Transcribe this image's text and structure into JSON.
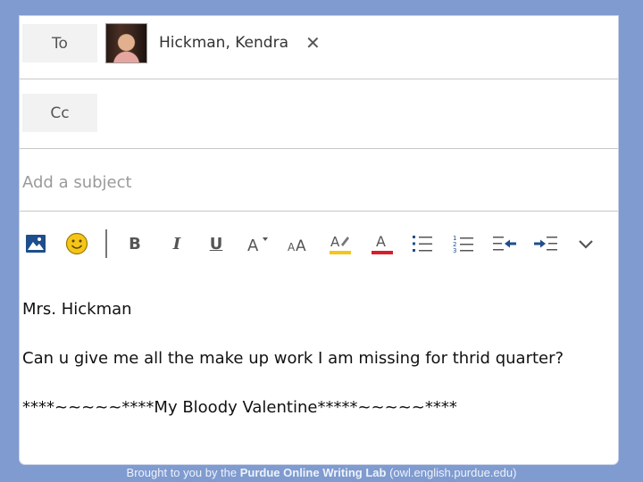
{
  "recipients": {
    "to_label": "To",
    "cc_label": "Cc",
    "to": [
      {
        "name": "Hickman, Kendra",
        "remove_label": "✕"
      }
    ]
  },
  "subject": {
    "placeholder": "Add a subject",
    "value": ""
  },
  "toolbar": {
    "buttons": [
      {
        "name": "insert-picture",
        "icon": "picture-icon"
      },
      {
        "name": "emoji",
        "icon": "emoji-icon"
      },
      {
        "name": "bold",
        "icon": "bold-icon",
        "label": "B"
      },
      {
        "name": "italic",
        "icon": "italic-icon",
        "label": "I"
      },
      {
        "name": "underline",
        "icon": "underline-icon",
        "label": "U"
      },
      {
        "name": "font-size",
        "icon": "font-size-icon"
      },
      {
        "name": "font-style",
        "icon": "font-style-icon"
      },
      {
        "name": "highlight",
        "icon": "highlight-icon"
      },
      {
        "name": "font-color",
        "icon": "font-color-icon"
      },
      {
        "name": "bullets",
        "icon": "bullets-icon"
      },
      {
        "name": "numbering",
        "icon": "numbering-icon"
      },
      {
        "name": "decrease-indent",
        "icon": "decrease-indent-icon"
      },
      {
        "name": "increase-indent",
        "icon": "increase-indent-icon"
      },
      {
        "name": "more",
        "icon": "chevron-down-icon"
      }
    ],
    "colors": {
      "picture": "#1e4e8c",
      "emoji": "#f5c518",
      "highlight": "#f5c518",
      "font_color": "#d81e2a"
    }
  },
  "message": {
    "lines": [
      "Mrs. Hickman",
      "Can u give me all the make up work I am missing for thrid quarter?",
      "****~~~~~****My Bloody Valentine*****~~~~~****"
    ]
  },
  "footer": {
    "prefix": "Brought to you by the ",
    "brand": "Purdue Online Writing Lab",
    "suffix": " (owl.english.purdue.edu)"
  }
}
